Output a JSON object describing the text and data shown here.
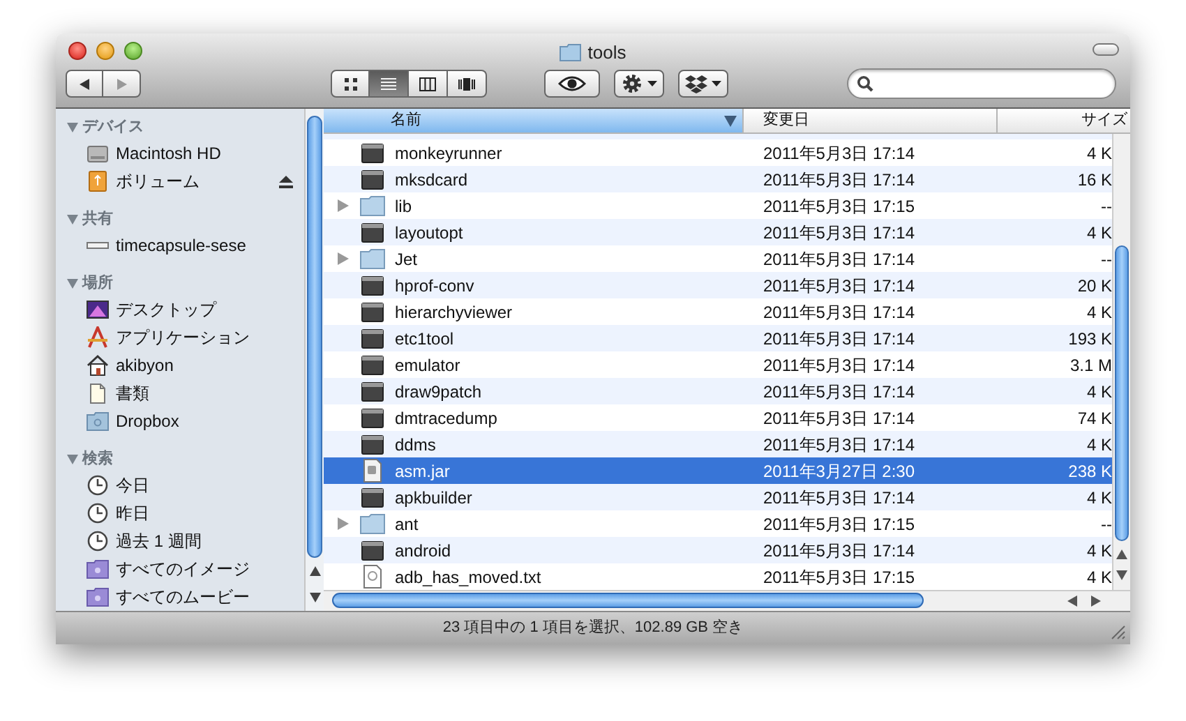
{
  "window": {
    "title": "tools"
  },
  "toolbar": {
    "view_buttons": [
      {
        "kind": "icons",
        "selected": false
      },
      {
        "kind": "list",
        "selected": true
      },
      {
        "kind": "columns",
        "selected": false
      },
      {
        "kind": "coverflow",
        "selected": false
      }
    ],
    "action_buttons": [
      {
        "kind": "quicklook"
      },
      {
        "kind": "gear"
      },
      {
        "kind": "dropbox"
      }
    ]
  },
  "sidebar": {
    "sections": [
      {
        "title": "デバイス",
        "expanded": true,
        "items": [
          {
            "label": "Macintosh HD",
            "kind": "disk",
            "eject": false
          },
          {
            "label": "ボリューム",
            "kind": "volume",
            "eject": true
          }
        ]
      },
      {
        "title": "共有",
        "expanded": true,
        "items": [
          {
            "label": "timecapsule-sese",
            "kind": "server",
            "eject": false
          }
        ]
      },
      {
        "title": "場所",
        "expanded": true,
        "items": [
          {
            "label": "デスクトップ",
            "kind": "desktop",
            "eject": false
          },
          {
            "label": "アプリケーション",
            "kind": "apps",
            "eject": false
          },
          {
            "label": "akibyon",
            "kind": "home",
            "eject": false
          },
          {
            "label": "書類",
            "kind": "documents",
            "eject": false
          },
          {
            "label": "Dropbox",
            "kind": "folder",
            "eject": false
          }
        ]
      },
      {
        "title": "検索",
        "expanded": true,
        "items": [
          {
            "label": "今日",
            "kind": "clock",
            "eject": false
          },
          {
            "label": "昨日",
            "kind": "clock",
            "eject": false
          },
          {
            "label": "過去 1 週間",
            "kind": "clock",
            "eject": false
          },
          {
            "label": "すべてのイメージ",
            "kind": "smart",
            "eject": false
          },
          {
            "label": "すべてのムービー",
            "kind": "smart",
            "eject": false
          }
        ]
      }
    ]
  },
  "columns": [
    {
      "label": "名前",
      "sorted": true
    },
    {
      "label": "変更日",
      "sorted": false
    },
    {
      "label": "サイズ",
      "sorted": false
    }
  ],
  "rows": [
    {
      "name": "monkeyrunner",
      "kind": "exec",
      "expandable": false,
      "date": "2011年5月3日 17:14",
      "size": "4 K",
      "selected": false
    },
    {
      "name": "mksdcard",
      "kind": "exec",
      "expandable": false,
      "date": "2011年5月3日 17:14",
      "size": "16 K",
      "selected": false
    },
    {
      "name": "lib",
      "kind": "folder",
      "expandable": true,
      "date": "2011年5月3日 17:15",
      "size": "--",
      "selected": false
    },
    {
      "name": "layoutopt",
      "kind": "exec",
      "expandable": false,
      "date": "2011年5月3日 17:14",
      "size": "4 K",
      "selected": false
    },
    {
      "name": "Jet",
      "kind": "folder",
      "expandable": true,
      "date": "2011年5月3日 17:14",
      "size": "--",
      "selected": false
    },
    {
      "name": "hprof-conv",
      "kind": "exec",
      "expandable": false,
      "date": "2011年5月3日 17:14",
      "size": "20 K",
      "selected": false
    },
    {
      "name": "hierarchyviewer",
      "kind": "exec",
      "expandable": false,
      "date": "2011年5月3日 17:14",
      "size": "4 K",
      "selected": false
    },
    {
      "name": "etc1tool",
      "kind": "exec",
      "expandable": false,
      "date": "2011年5月3日 17:14",
      "size": "193 K",
      "selected": false
    },
    {
      "name": "emulator",
      "kind": "exec",
      "expandable": false,
      "date": "2011年5月3日 17:14",
      "size": "3.1 M",
      "selected": false
    },
    {
      "name": "draw9patch",
      "kind": "exec",
      "expandable": false,
      "date": "2011年5月3日 17:14",
      "size": "4 K",
      "selected": false
    },
    {
      "name": "dmtracedump",
      "kind": "exec",
      "expandable": false,
      "date": "2011年5月3日 17:14",
      "size": "74 K",
      "selected": false
    },
    {
      "name": "ddms",
      "kind": "exec",
      "expandable": false,
      "date": "2011年5月3日 17:14",
      "size": "4 K",
      "selected": false
    },
    {
      "name": "asm.jar",
      "kind": "jar",
      "expandable": false,
      "date": "2011年3月27日 2:30",
      "size": "238 K",
      "selected": true
    },
    {
      "name": "apkbuilder",
      "kind": "exec",
      "expandable": false,
      "date": "2011年5月3日 17:14",
      "size": "4 K",
      "selected": false
    },
    {
      "name": "ant",
      "kind": "folder",
      "expandable": true,
      "date": "2011年5月3日 17:15",
      "size": "--",
      "selected": false
    },
    {
      "name": "android",
      "kind": "exec",
      "expandable": false,
      "date": "2011年5月3日 17:14",
      "size": "4 K",
      "selected": false
    },
    {
      "name": "adb_has_moved.txt",
      "kind": "text",
      "expandable": false,
      "date": "2011年5月3日 17:15",
      "size": "4 K",
      "selected": false
    }
  ],
  "status_bar": "23 項目中の 1 項目を選択、102.89 GB 空き"
}
